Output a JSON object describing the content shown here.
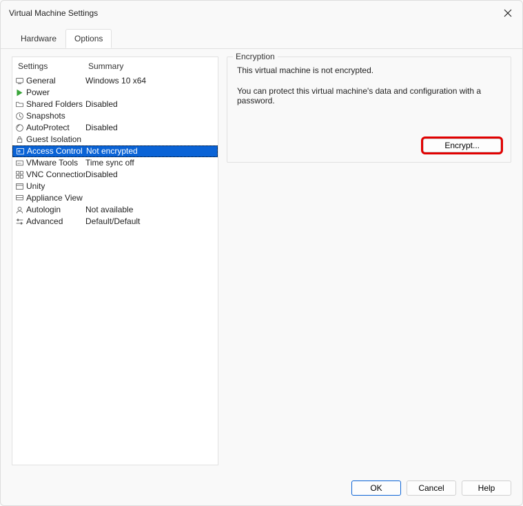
{
  "window": {
    "title": "Virtual Machine Settings"
  },
  "tabs": {
    "hardware": "Hardware",
    "options": "Options"
  },
  "listHeader": {
    "settings": "Settings",
    "summary": "Summary"
  },
  "rows": {
    "general": {
      "label": "General",
      "summary": "Windows 10 x64"
    },
    "power": {
      "label": "Power",
      "summary": ""
    },
    "sharedFolders": {
      "label": "Shared Folders",
      "summary": "Disabled"
    },
    "snapshots": {
      "label": "Snapshots",
      "summary": ""
    },
    "autoprotect": {
      "label": "AutoProtect",
      "summary": "Disabled"
    },
    "guestIsolation": {
      "label": "Guest Isolation",
      "summary": ""
    },
    "accessControl": {
      "label": "Access Control",
      "summary": "Not encrypted"
    },
    "vmwareTools": {
      "label": "VMware Tools",
      "summary": "Time sync off"
    },
    "vncConnections": {
      "label": "VNC Connections",
      "summary": "Disabled"
    },
    "unity": {
      "label": "Unity",
      "summary": ""
    },
    "applianceView": {
      "label": "Appliance View",
      "summary": ""
    },
    "autologin": {
      "label": "Autologin",
      "summary": "Not available"
    },
    "advanced": {
      "label": "Advanced",
      "summary": "Default/Default"
    }
  },
  "encryption": {
    "legend": "Encryption",
    "line1": "This virtual machine is not encrypted.",
    "line2": "You can protect this virtual machine's data and configuration with a password.",
    "button": "Encrypt..."
  },
  "footer": {
    "ok": "OK",
    "cancel": "Cancel",
    "help": "Help"
  }
}
